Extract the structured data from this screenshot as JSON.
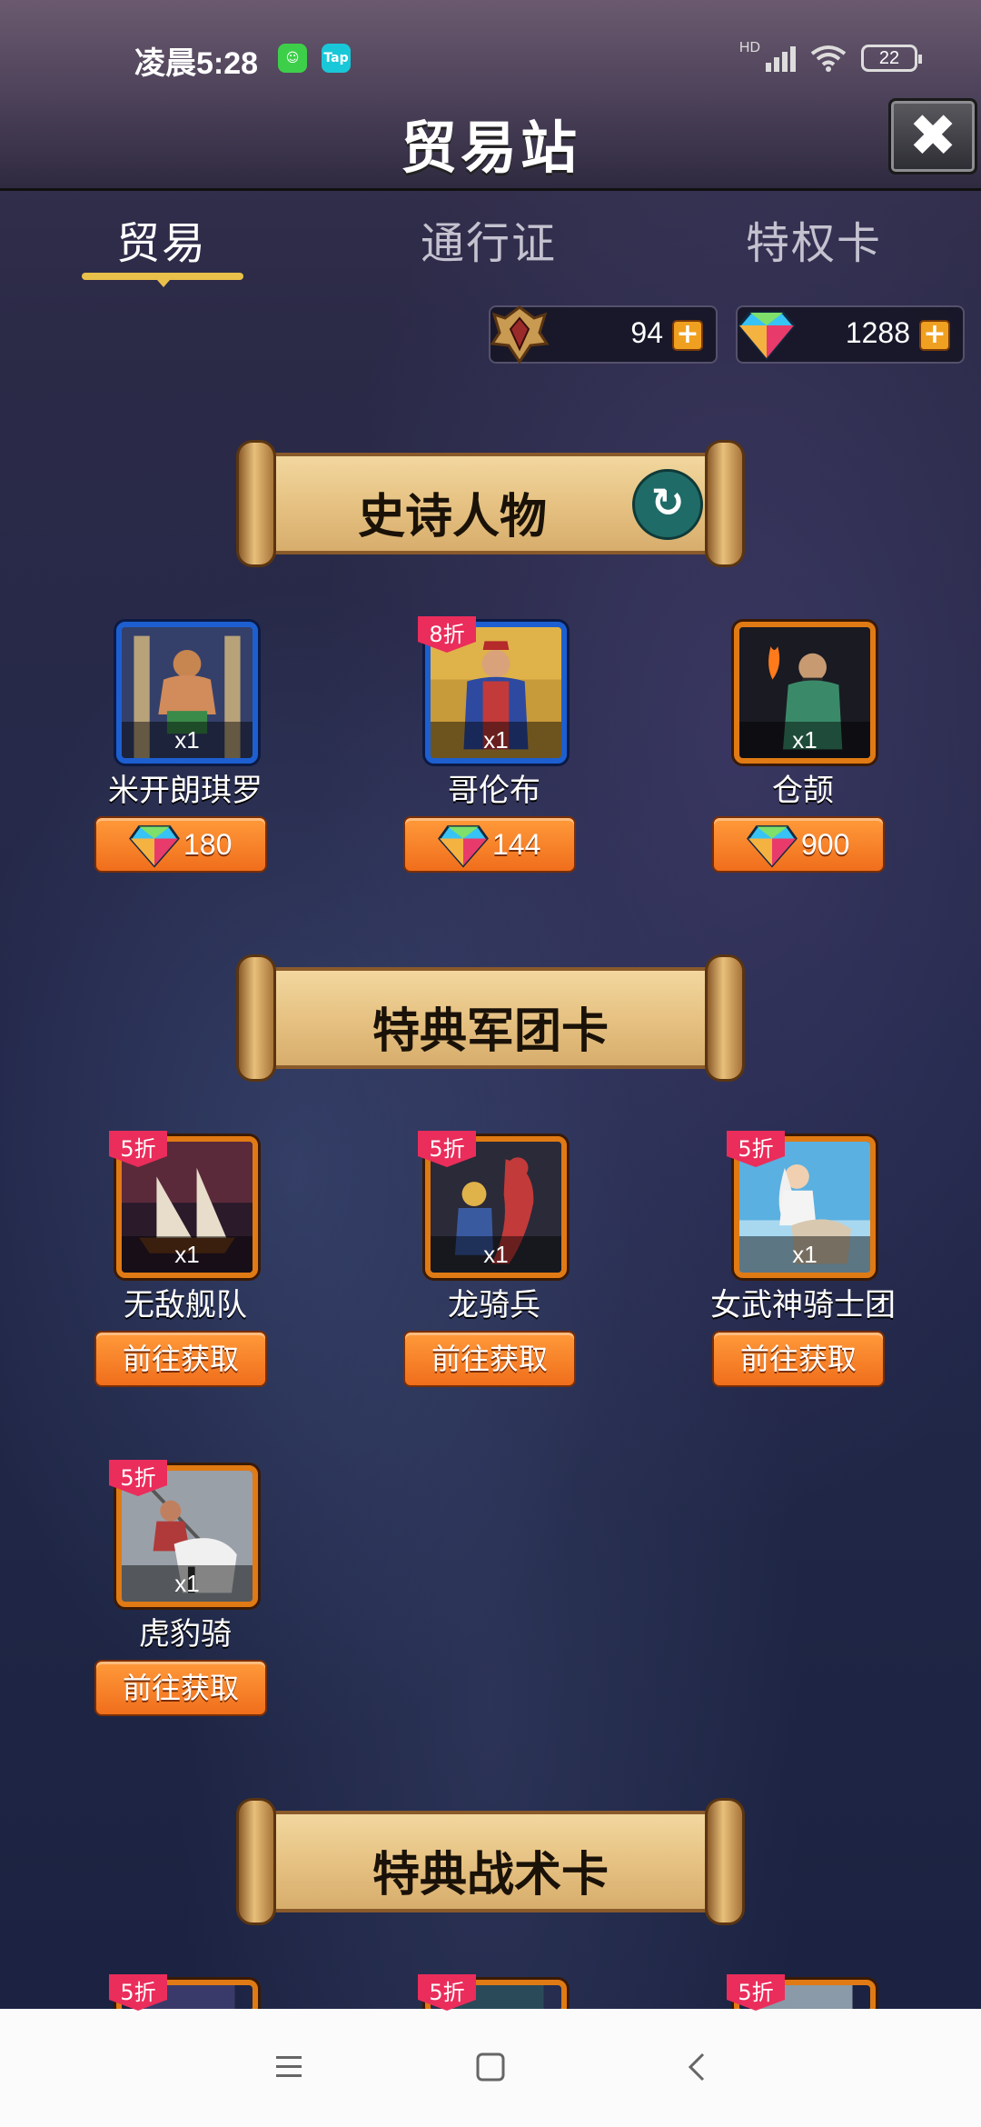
{
  "status_bar": {
    "time": "凌晨5:28",
    "app_icon_1": "☺",
    "app_icon_2": "Tap",
    "network": "HD",
    "battery": "22"
  },
  "header": {
    "title": "贸易站",
    "close_icon": "✖"
  },
  "tabs": [
    {
      "label": "贸易"
    },
    {
      "label": "通行证"
    },
    {
      "label": "特权卡"
    }
  ],
  "currencies": [
    {
      "icon": "crest-icon",
      "value": "94",
      "plus": "+"
    },
    {
      "icon": "gem-icon",
      "value": "1288",
      "plus": "+"
    }
  ],
  "sections": [
    {
      "title": "史诗人物",
      "refresh_icon": "↻",
      "items": [
        {
          "name": "米开朗琪罗",
          "qty": "x1",
          "price": "180",
          "badge": ""
        },
        {
          "name": "哥伦布",
          "qty": "x1",
          "price": "144",
          "badge": "8折"
        },
        {
          "name": "仓颉",
          "qty": "x1",
          "price": "900",
          "badge": ""
        }
      ]
    },
    {
      "title": "特典军团卡",
      "items": [
        {
          "name": "无敌舰队",
          "qty": "x1",
          "button": "前往获取",
          "badge": "5折"
        },
        {
          "name": "龙骑兵",
          "qty": "x1",
          "button": "前往获取",
          "badge": "5折"
        },
        {
          "name": "女武神骑士团",
          "qty": "x1",
          "button": "前往获取",
          "badge": "5折"
        },
        {
          "name": "虎豹骑",
          "qty": "x1",
          "button": "前往获取",
          "badge": "5折"
        }
      ]
    },
    {
      "title": "特典战术卡",
      "items": [
        {
          "badge": "5折"
        },
        {
          "badge": "5折"
        },
        {
          "badge": "5折"
        }
      ]
    }
  ],
  "colors": {
    "accent_orange": "#f06e1c",
    "badge_red": "#ea2d5b",
    "frame_blue": "#1d5fd0",
    "frame_orange": "#e07a14",
    "tab_gold": "#e8c04a"
  }
}
